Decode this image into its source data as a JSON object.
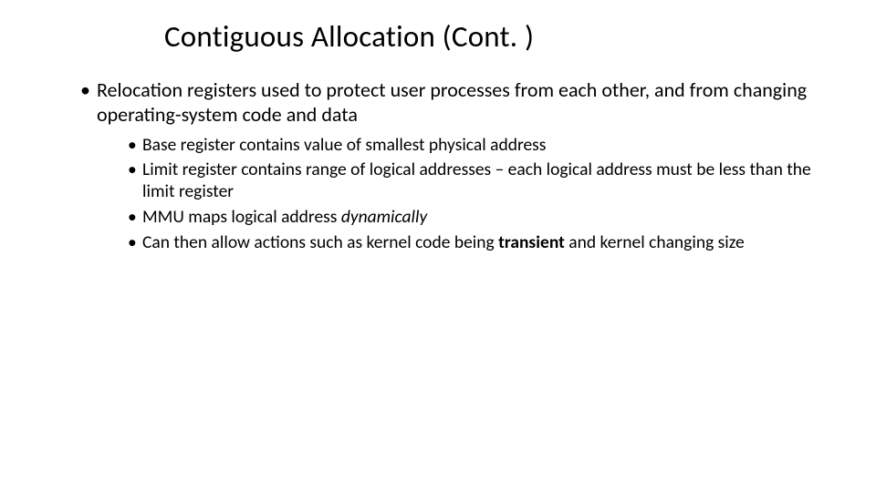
{
  "title": "Contiguous Allocation (Cont. )",
  "b1": "Relocation registers used to protect user processes from each other, and from changing operating-system code and data",
  "s1": "Base register contains value of smallest physical address",
  "s2": "Limit register contains range of logical addresses – each logical address must be less than the limit register",
  "s3a": "MMU maps logical address ",
  "s3b": "dynamically",
  "s4a": "Can then allow actions such as kernel code being ",
  "s4b": "transient",
  "s4c": " and kernel changing size"
}
